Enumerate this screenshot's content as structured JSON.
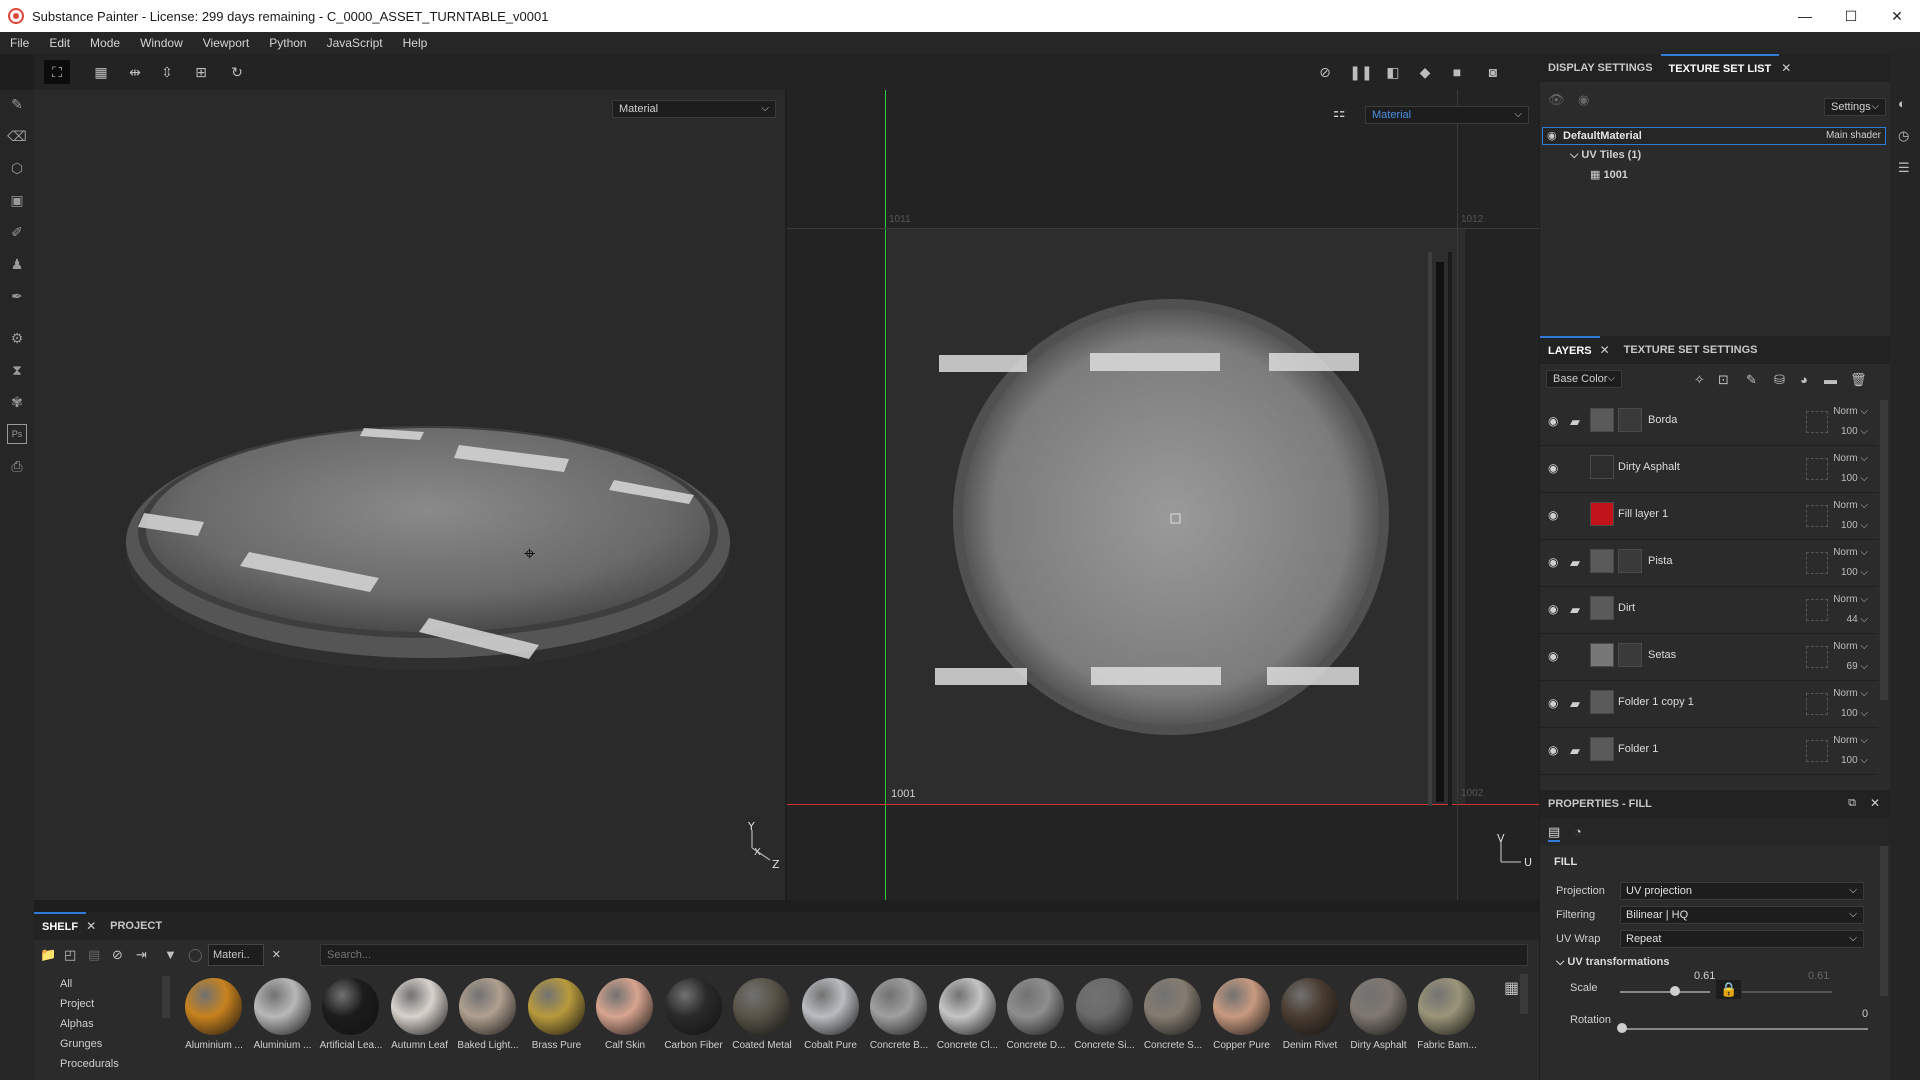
{
  "window": {
    "title": "Substance Painter - License: 299 days remaining - C_0000_ASSET_TURNTABLE_v0001",
    "minimize": "—",
    "maximize": "☐",
    "close": "✕"
  },
  "menu": [
    "File",
    "Edit",
    "Mode",
    "Window",
    "Viewport",
    "Python",
    "JavaScript",
    "Help"
  ],
  "viewport": {
    "left_select": "Material",
    "right_select": "Material",
    "uv_label_top_left": "1011",
    "uv_label_top_right": "1012",
    "uv_label_bottom_left": "1001",
    "uv_label_bottom_right": "1002",
    "axis_3d": {
      "y": "Y",
      "x": "X",
      "z": "Z"
    },
    "axis_2d": {
      "v": "V",
      "u": "U"
    }
  },
  "texture_set_panel": {
    "tabs": [
      "DISPLAY SETTINGS",
      "TEXTURE SET LIST"
    ],
    "settings_label": "Settings",
    "material_name": "DefaultMaterial",
    "shader_name": "Main shader",
    "uv_tiles_label": "UV Tiles (1)",
    "uv_tile": "1001"
  },
  "layers_panel": {
    "tabs": [
      "LAYERS",
      "TEXTURE SET SETTINGS"
    ],
    "channel_select": "Base Color",
    "layers": [
      {
        "name": "Borda",
        "mode": "Norm",
        "opacity": "100",
        "folder": true,
        "thumb_color": "#5a5a5a",
        "has_mask": true
      },
      {
        "name": "Dirty Asphalt",
        "mode": "Norm",
        "opacity": "100",
        "folder": false,
        "thumb_color": "#2d2d2d",
        "has_mask": false
      },
      {
        "name": "Fill layer 1",
        "mode": "Norm",
        "opacity": "100",
        "folder": false,
        "thumb_color": "#c0141a",
        "has_mask": false
      },
      {
        "name": "Pista",
        "mode": "Norm",
        "opacity": "100",
        "folder": true,
        "thumb_color": "#5a5a5a",
        "has_mask": true
      },
      {
        "name": "Dirt",
        "mode": "Norm",
        "opacity": "44",
        "folder": true,
        "thumb_color": "#5a5a5a",
        "has_mask": false
      },
      {
        "name": "Setas",
        "mode": "Norm",
        "opacity": "69",
        "folder": false,
        "thumb_color": "#777777",
        "has_mask": true
      },
      {
        "name": "Folder 1 copy 1",
        "mode": "Norm",
        "opacity": "100",
        "folder": true,
        "thumb_color": "#5a5a5a",
        "has_mask": false
      },
      {
        "name": "Folder 1",
        "mode": "Norm",
        "opacity": "100",
        "folder": true,
        "thumb_color": "#5a5a5a",
        "has_mask": false
      }
    ]
  },
  "properties": {
    "title": "PROPERTIES - FILL",
    "section": "FILL",
    "projection_label": "Projection",
    "projection_value": "UV projection",
    "filtering_label": "Filtering",
    "filtering_value": "Bilinear | HQ",
    "uvwrap_label": "UV Wrap",
    "uvwrap_value": "Repeat",
    "uv_transform_label": "UV transformations",
    "scale_label": "Scale",
    "scale_value": "0.61",
    "scale_value_right": "0.61",
    "scale_fraction": 0.61,
    "rotation_label": "Rotation",
    "rotation_value": "0",
    "rotation_fraction": 0
  },
  "shelf": {
    "tabs": [
      "SHELF",
      "PROJECT"
    ],
    "filter_chip": "Materi..",
    "search_placeholder": "Search...",
    "categories": [
      "All",
      "Project",
      "Alphas",
      "Grunges",
      "Procedurals"
    ],
    "materials": [
      {
        "name": "Aluminium ...",
        "color": "#c8821e"
      },
      {
        "name": "Aluminium ...",
        "color": "#b8b8b8"
      },
      {
        "name": "Artificial Lea...",
        "color": "#1c1c1c"
      },
      {
        "name": "Autumn Leaf",
        "color": "#d9d2cc"
      },
      {
        "name": "Baked Light...",
        "color": "#b0a090"
      },
      {
        "name": "Brass Pure",
        "color": "#b89a3c"
      },
      {
        "name": "Calf Skin",
        "color": "#d7a48f"
      },
      {
        "name": "Carbon Fiber",
        "color": "#2a2a2a"
      },
      {
        "name": "Coated Metal",
        "color": "#595448"
      },
      {
        "name": "Cobalt Pure",
        "color": "#b9bcc0"
      },
      {
        "name": "Concrete B...",
        "color": "#9f9f9f"
      },
      {
        "name": "Concrete Cl...",
        "color": "#c4c4c4"
      },
      {
        "name": "Concrete D...",
        "color": "#8e8e8e"
      },
      {
        "name": "Concrete Si...",
        "color": "#6a6a6a"
      },
      {
        "name": "Concrete S...",
        "color": "#857c70"
      },
      {
        "name": "Copper Pure",
        "color": "#c89a80"
      },
      {
        "name": "Denim Rivet",
        "color": "#4a3c30"
      },
      {
        "name": "Dirty Asphalt",
        "color": "#807870"
      },
      {
        "name": "Fabric Bam...",
        "color": "#9a9478"
      }
    ]
  }
}
